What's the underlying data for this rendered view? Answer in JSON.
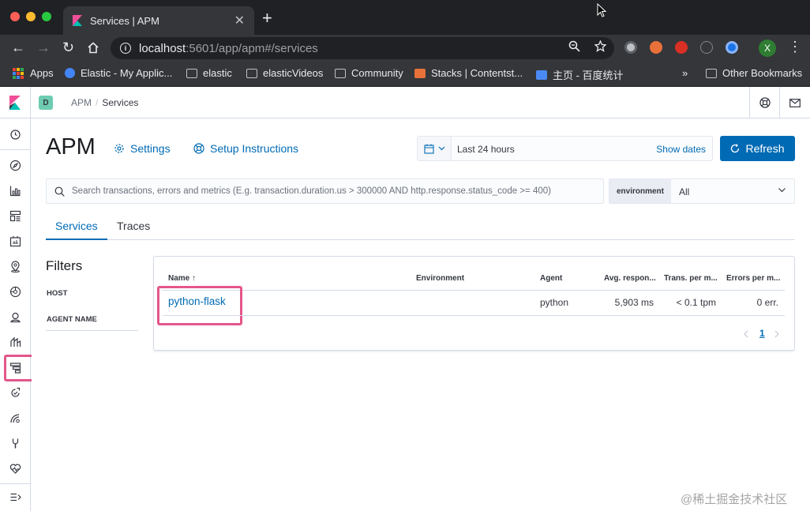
{
  "browser": {
    "tab_title": "Services | APM",
    "url_host": "localhost",
    "url_rest": ":5601/app/apm#/services",
    "profile_initial": "X",
    "bookmarks": [
      "Apps",
      "Elastic - My Applic...",
      "elastic",
      "elasticVideos",
      "Community",
      "Stacks | Contentst...",
      "主页 - 百度统计"
    ],
    "overflow": "»",
    "other_bookmarks": "Other Bookmarks"
  },
  "kibana": {
    "space_initial": "D",
    "breadcrumb_root": "APM",
    "breadcrumb_current": "Services"
  },
  "apm": {
    "title": "APM",
    "settings_label": "Settings",
    "setup_label": "Setup Instructions",
    "date_range": "Last 24 hours",
    "show_dates": "Show dates",
    "refresh_label": "Refresh",
    "search_placeholder": "Search transactions, errors and metrics (E.g. transaction.duration.us > 300000 AND http.response.status_code >= 400)",
    "env_label": "environment",
    "env_value": "All",
    "tabs": [
      "Services",
      "Traces"
    ],
    "filters_title": "Filters",
    "filters": [
      "HOST",
      "AGENT NAME"
    ],
    "table": {
      "headers": [
        "Name",
        "Environment",
        "Agent",
        "Avg. respon...",
        "Trans. per m...",
        "Errors per m..."
      ],
      "sort_arrow": "↑",
      "rows": [
        {
          "name": "python-flask",
          "environment": "",
          "agent": "python",
          "avg_response": "5,903 ms",
          "trans_per_min": "< 0.1 tpm",
          "errors_per_min": "0 err."
        }
      ],
      "page": "1"
    }
  },
  "watermark": "@稀土掘金技术社区",
  "colors": {
    "accent": "#006bb4",
    "highlight": "#e4568a"
  }
}
